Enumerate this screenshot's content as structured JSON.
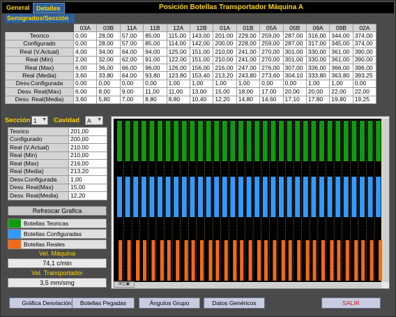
{
  "tabs": [
    {
      "label": "General"
    },
    {
      "label": "Detalles"
    }
  ],
  "window_title": "Posición Botellas Transportador Máquina A",
  "semigrados_header": "Semigrados/Sección",
  "main_table": {
    "columns": [
      "03A",
      "03B",
      "11A",
      "11B",
      "12A",
      "12B",
      "01A",
      "01B",
      "05A",
      "05B",
      "09A",
      "09B",
      "02A"
    ],
    "rows": [
      {
        "label": "Teorico",
        "values": [
          "0,00",
          "28,00",
          "57,00",
          "85,00",
          "115,00",
          "143,00",
          "201,00",
          "229,00",
          "259,00",
          "287,00",
          "316,00",
          "344,00",
          "374,00"
        ]
      },
      {
        "label": "Configurado",
        "values": [
          "0,00",
          "28,00",
          "57,00",
          "85,00",
          "114,00",
          "142,00",
          "200,00",
          "228,00",
          "259,00",
          "287,00",
          "317,00",
          "345,00",
          "374,00"
        ]
      },
      {
        "label": "Real (V.Actual)",
        "values": [
          "4,00",
          "34,00",
          "64,00",
          "94,00",
          "125,00",
          "151,00",
          "210,00",
          "241,00",
          "270,00",
          "301,00",
          "330,00",
          "361,00",
          "390,00"
        ]
      },
      {
        "label": "Real (Min)",
        "values": [
          "2,00",
          "32,00",
          "62,00",
          "91,00",
          "122,00",
          "151,00",
          "210,00",
          "241,00",
          "270,00",
          "301,00",
          "330,00",
          "361,00",
          "390,00"
        ]
      },
      {
        "label": "Real (Max)",
        "values": [
          "6,00",
          "36,00",
          "66,00",
          "96,00",
          "126,00",
          "156,00",
          "216,00",
          "247,00",
          "276,00",
          "307,00",
          "336,00",
          "366,00",
          "396,00"
        ]
      },
      {
        "label": "Real (Media)",
        "values": [
          "3,60",
          "33,80",
          "64,00",
          "93,80",
          "123,80",
          "153,40",
          "213,20",
          "243,80",
          "273,60",
          "304,10",
          "333,80",
          "363,80",
          "393,25"
        ]
      },
      {
        "label": "Desv.Configurada",
        "values": [
          "0,00",
          "0,00",
          "0,00",
          "0,00",
          "1,00",
          "1,00",
          "1,00",
          "1,00",
          "0,00",
          "0,00",
          "1,00",
          "1,00",
          "0,00"
        ]
      },
      {
        "label": "Desv. Real(Max)",
        "values": [
          "6,00",
          "8,00",
          "9,00",
          "11,00",
          "11,00",
          "13,00",
          "15,00",
          "18,00",
          "17,00",
          "20,00",
          "20,00",
          "22,00",
          "22,00"
        ]
      },
      {
        "label": "Desv. Real(Media)",
        "values": [
          "3,60",
          "5,80",
          "7,00",
          "8,80",
          "8,80",
          "10,40",
          "12,20",
          "14,80",
          "14,60",
          "17,10",
          "17,80",
          "19,80",
          "19,25"
        ]
      }
    ]
  },
  "seccion": {
    "label": "Sección",
    "value": "1"
  },
  "cavidad": {
    "label": "Cavidad",
    "value": "A"
  },
  "detail_table": [
    {
      "label": "Teorico",
      "value": "201,00"
    },
    {
      "label": "Configurado",
      "value": "200,00"
    },
    {
      "label": "Real (V.Actual)",
      "value": "210,00"
    },
    {
      "label": "Real (Min)",
      "value": "210,00"
    },
    {
      "label": "Real (Max)",
      "value": "216,00"
    },
    {
      "label": "Real (Media)",
      "value": "213,20"
    },
    {
      "label": "Desv.Configurada",
      "value": "1,00"
    },
    {
      "label": "Desv. Real(Max)",
      "value": "15,00"
    },
    {
      "label": "Desv. Real(Media)",
      "value": "12,20"
    }
  ],
  "refresh_button": "Refrescar Grafica",
  "legend": [
    {
      "label": "Botellas Teoricas",
      "color": "#119a11"
    },
    {
      "label": "Botellas Configuradas",
      "color": "#3399ff"
    },
    {
      "label": "Botellas Reales",
      "color": "#f26a18"
    }
  ],
  "vel_maquina": {
    "label": "Vel. Máquina",
    "value": "74,1 c/min"
  },
  "vel_transportador": {
    "label": "Vel. Transportador",
    "value": "3,5 mm/smg"
  },
  "bottom_buttons": {
    "grafica": "Gráfica Desviación",
    "pegadas": "Botellas Pegadas",
    "angulos": "Ángulos Grupo",
    "datos": "Datos Genéricos",
    "salir": "SALIR"
  },
  "colors": {
    "background": "#4a4a4a",
    "accent_yellow": "#ffd800",
    "tab_blue": "#2c5f9e",
    "teoricas": "#119a11",
    "configuradas": "#3399ff",
    "reales": "#f26a18",
    "salir": "#d01818"
  }
}
